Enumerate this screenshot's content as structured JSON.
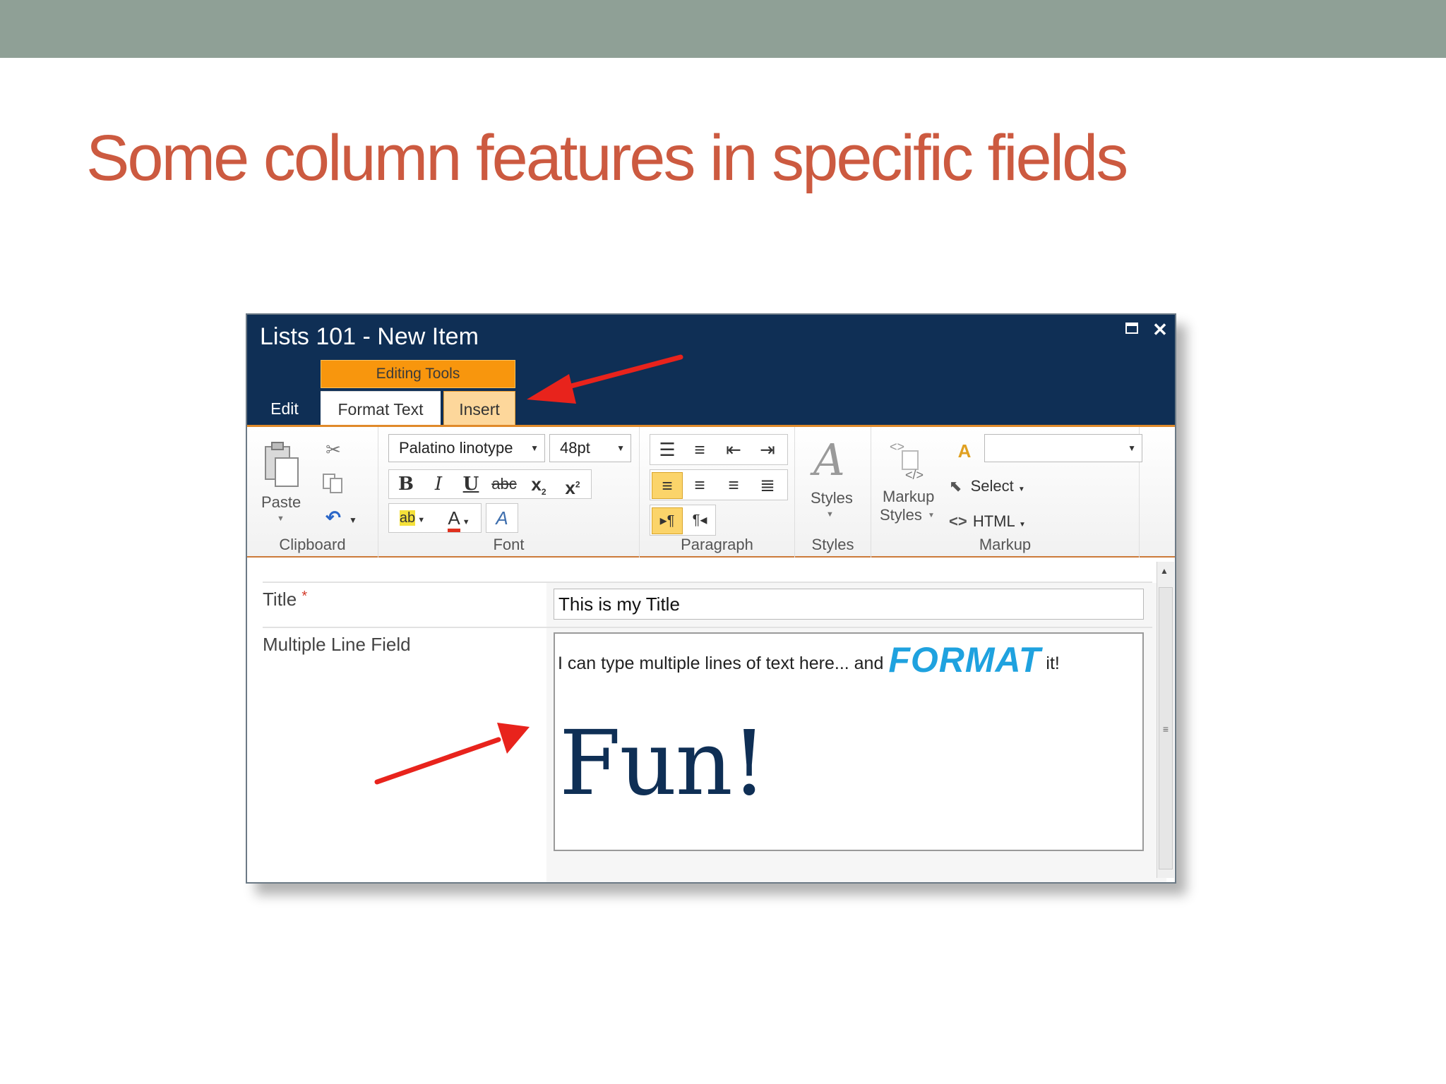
{
  "slide": {
    "title": "Some column features in specific fields"
  },
  "window": {
    "title": "Lists 101 - New Item"
  },
  "ribbon_tabs": {
    "context_group": "Editing Tools",
    "edit": "Edit",
    "format_text": "Format Text",
    "insert": "Insert",
    "active": "Format Text"
  },
  "clipboard": {
    "paste": "Paste",
    "label": "Clipboard"
  },
  "font": {
    "family": "Palatino linotype",
    "size": "48pt",
    "label": "Font"
  },
  "paragraph": {
    "label": "Paragraph"
  },
  "styles": {
    "button": "Styles",
    "label": "Styles"
  },
  "markup": {
    "markup_styles_line1": "Markup",
    "markup_styles_line2": "Styles",
    "select": "Select",
    "html": "HTML",
    "label": "Markup",
    "combo_value": ""
  },
  "form": {
    "title_label": "Title",
    "required_marker": "*",
    "title_value": "This is my Title",
    "multiline_label": "Multiple Line Field",
    "rte_text_before": "I can type multiple lines of text here... and",
    "rte_format_word": "FORMAT",
    "rte_text_after": "it!",
    "rte_big_text": "Fun!"
  },
  "colors": {
    "slide_bar": "#8fa096",
    "slide_title": "#cc5a40",
    "window_title_bar": "#0f2f55",
    "context_tab": "#f8960d",
    "format_word": "#1fa2df",
    "annotation_arrow": "#e8231c"
  }
}
